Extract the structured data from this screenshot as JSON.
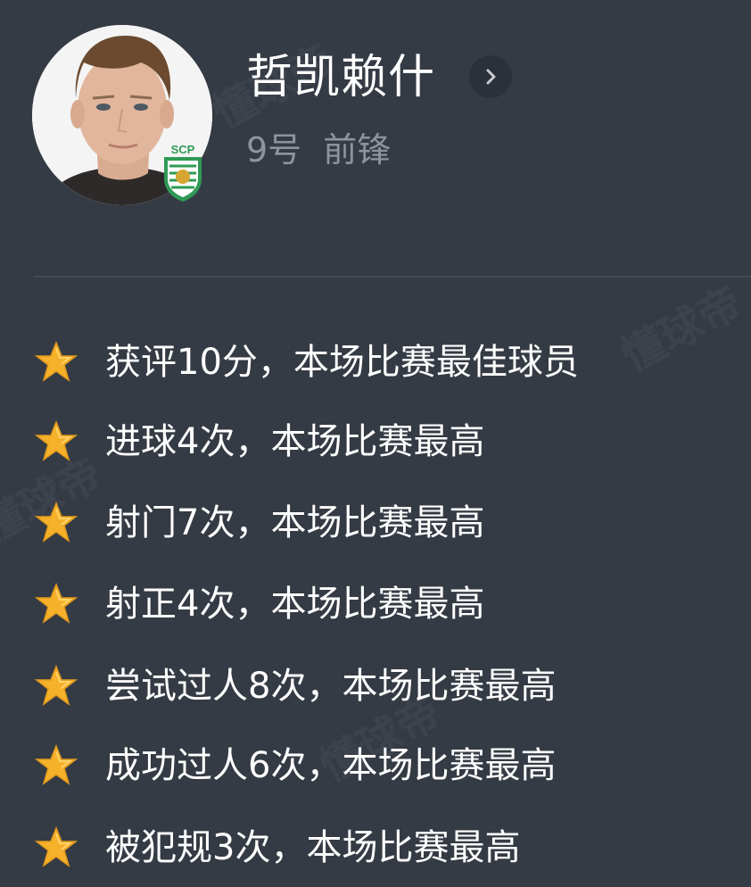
{
  "player": {
    "name": "哲凯赖什",
    "number": "9号",
    "position": "前锋",
    "club_badge_text": "SCP"
  },
  "watermark": "懂球帝",
  "achievements": [
    {
      "icon": "star-icon",
      "text": "获评10分，本场比赛最佳球员"
    },
    {
      "icon": "star-icon",
      "text": "进球4次，本场比赛最高"
    },
    {
      "icon": "star-icon",
      "text": "射门7次，本场比赛最高"
    },
    {
      "icon": "star-icon",
      "text": "射正4次，本场比赛最高"
    },
    {
      "icon": "star-icon",
      "text": "尝试过人8次，本场比赛最高"
    },
    {
      "icon": "star-icon",
      "text": "成功过人6次，本场比赛最高"
    },
    {
      "icon": "star-icon",
      "text": "被犯规3次，本场比赛最高"
    }
  ],
  "colors": {
    "background": "#353b44",
    "star": "#f6b12b",
    "badge_green": "#2f9a55"
  }
}
